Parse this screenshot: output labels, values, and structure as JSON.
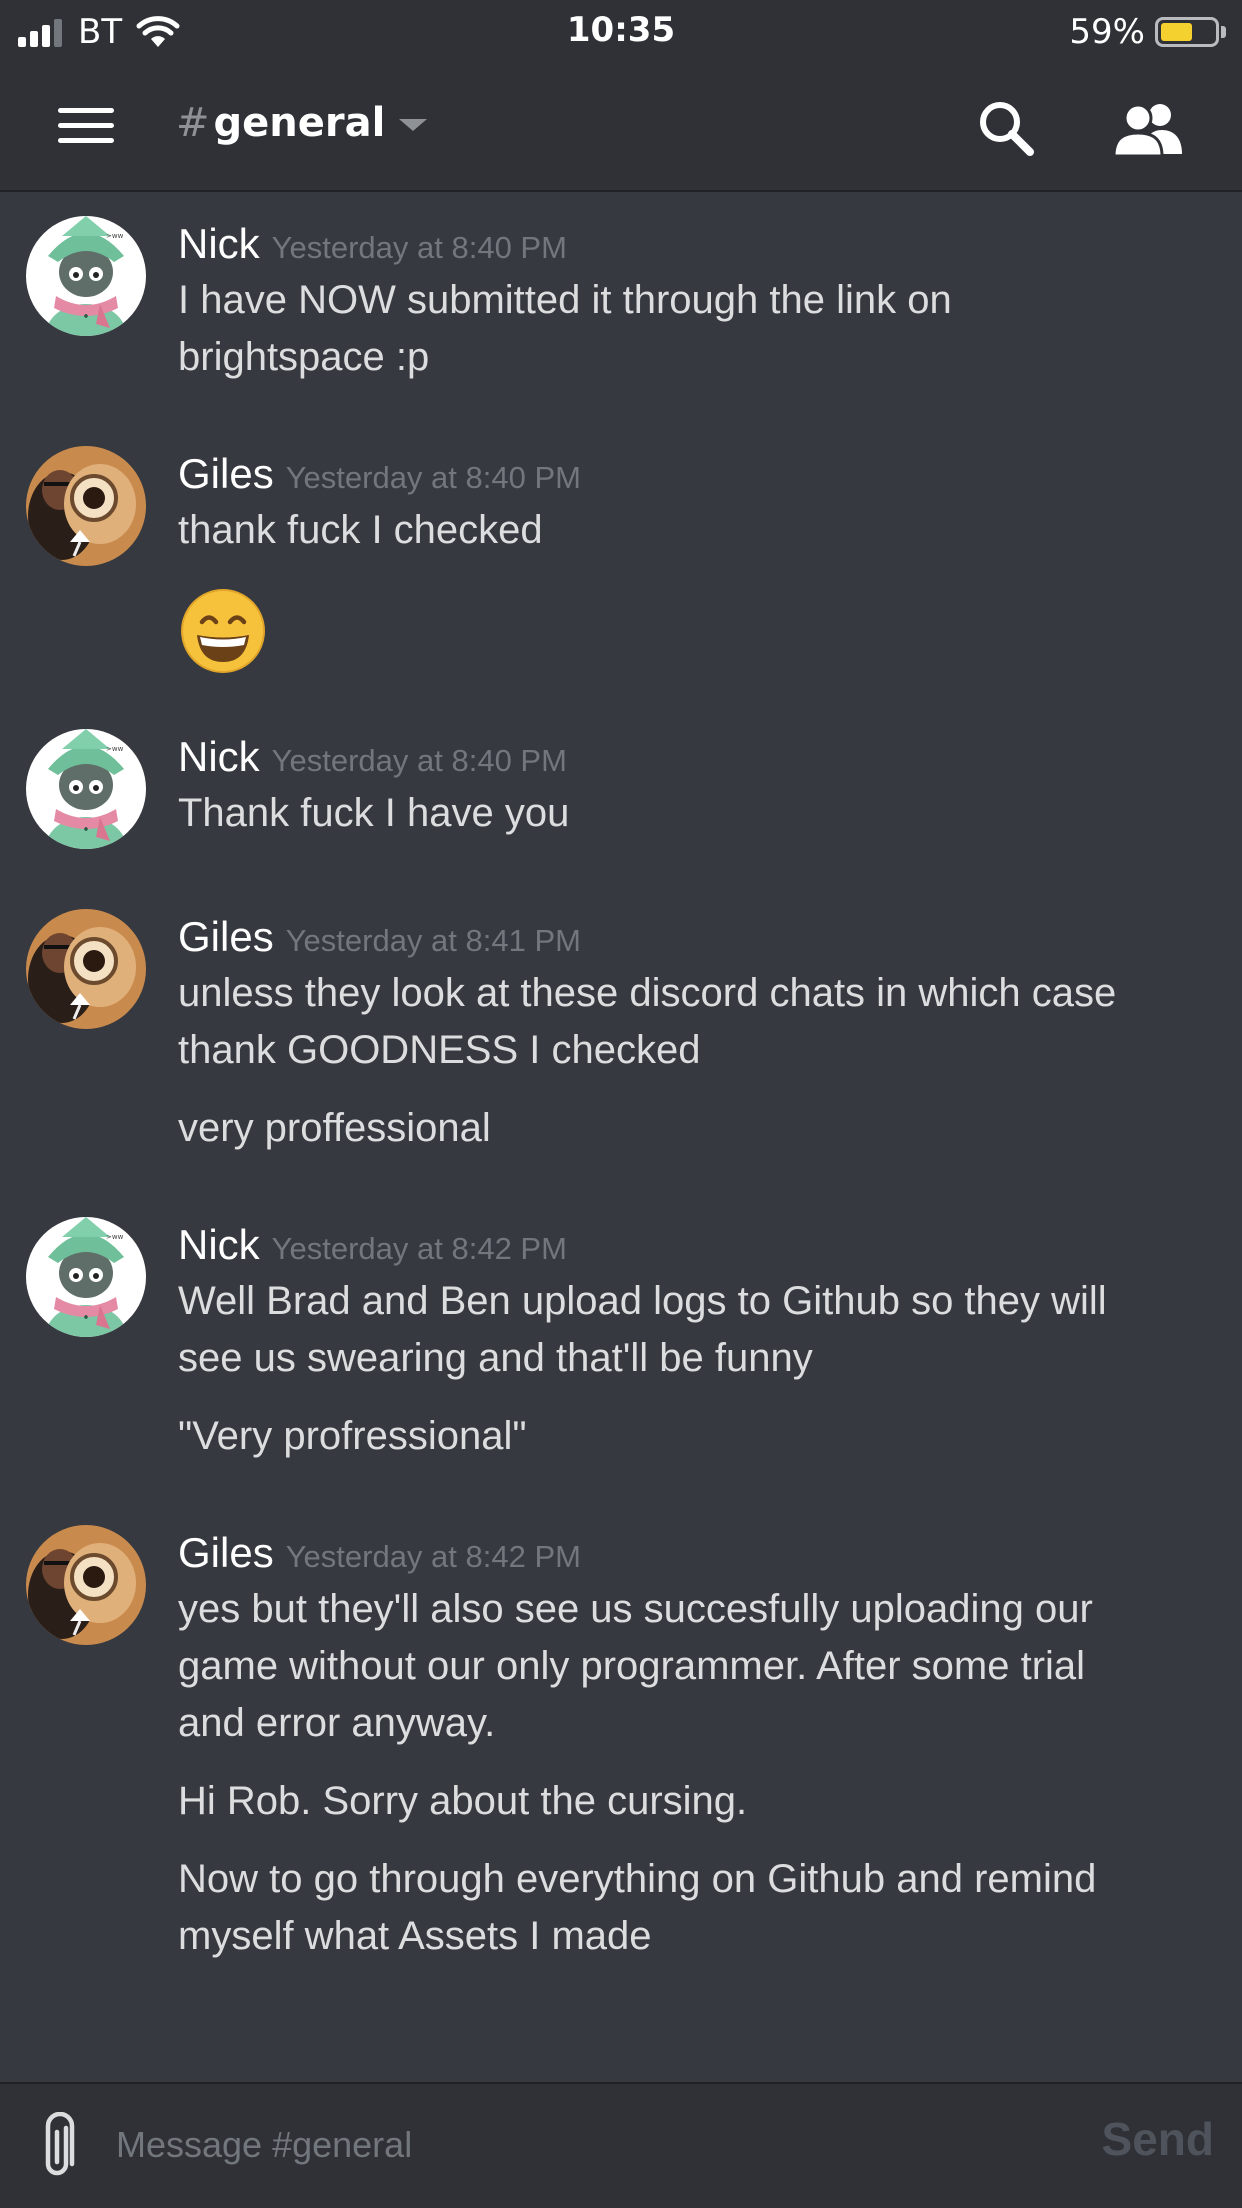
{
  "status_bar": {
    "carrier": "BT",
    "time": "10:35",
    "battery_percent": "59%",
    "battery_level": 0.59,
    "signal_bars": 3
  },
  "header": {
    "hash": "#",
    "channel_name": "general",
    "menu_icon": "hamburger-icon",
    "search_icon": "search-icon",
    "members_icon": "members-icon"
  },
  "messages": [
    {
      "author": "Nick",
      "timestamp": "Yesterday at 8:40 PM",
      "avatar": "nick-avatar",
      "lines": [
        "I have NOW submitted it through the link on\nbrightspace :p"
      ]
    },
    {
      "author": "Giles",
      "timestamp": "Yesterday at 8:40 PM",
      "avatar": "giles-avatar",
      "lines": [
        "thank fuck I checked"
      ],
      "emoji": "grinning-face-emoji"
    },
    {
      "author": "Nick",
      "timestamp": "Yesterday at 8:40 PM",
      "avatar": "nick-avatar",
      "lines": [
        "Thank fuck I have you"
      ]
    },
    {
      "author": "Giles",
      "timestamp": "Yesterday at 8:41 PM",
      "avatar": "giles-avatar",
      "lines": [
        "unless they look at these discord chats in which case\nthank GOODNESS I checked",
        "very proffessional"
      ]
    },
    {
      "author": "Nick",
      "timestamp": "Yesterday at 8:42 PM",
      "avatar": "nick-avatar",
      "lines": [
        "Well Brad and Ben upload logs to Github so they will\nsee us swearing and that'll be funny",
        "\"Very profressional\""
      ]
    },
    {
      "author": "Giles",
      "timestamp": "Yesterday at 8:42 PM",
      "avatar": "giles-avatar",
      "lines": [
        "yes but they'll also see us succesfully uploading our\ngame without our only programmer. After some trial\nand error anyway.",
        "Hi Rob. Sorry about the cursing.",
        "Now to go through everything on Github and remind\nmyself what Assets I made"
      ]
    }
  ],
  "input": {
    "placeholder": "Message #general",
    "value": "",
    "send_label": "Send",
    "attach_icon": "paperclip-icon"
  },
  "colors": {
    "background": "#36393f",
    "header": "#2f3136",
    "text": "#dcddde",
    "timestamp": "#72767d",
    "battery": "#f5d130"
  }
}
